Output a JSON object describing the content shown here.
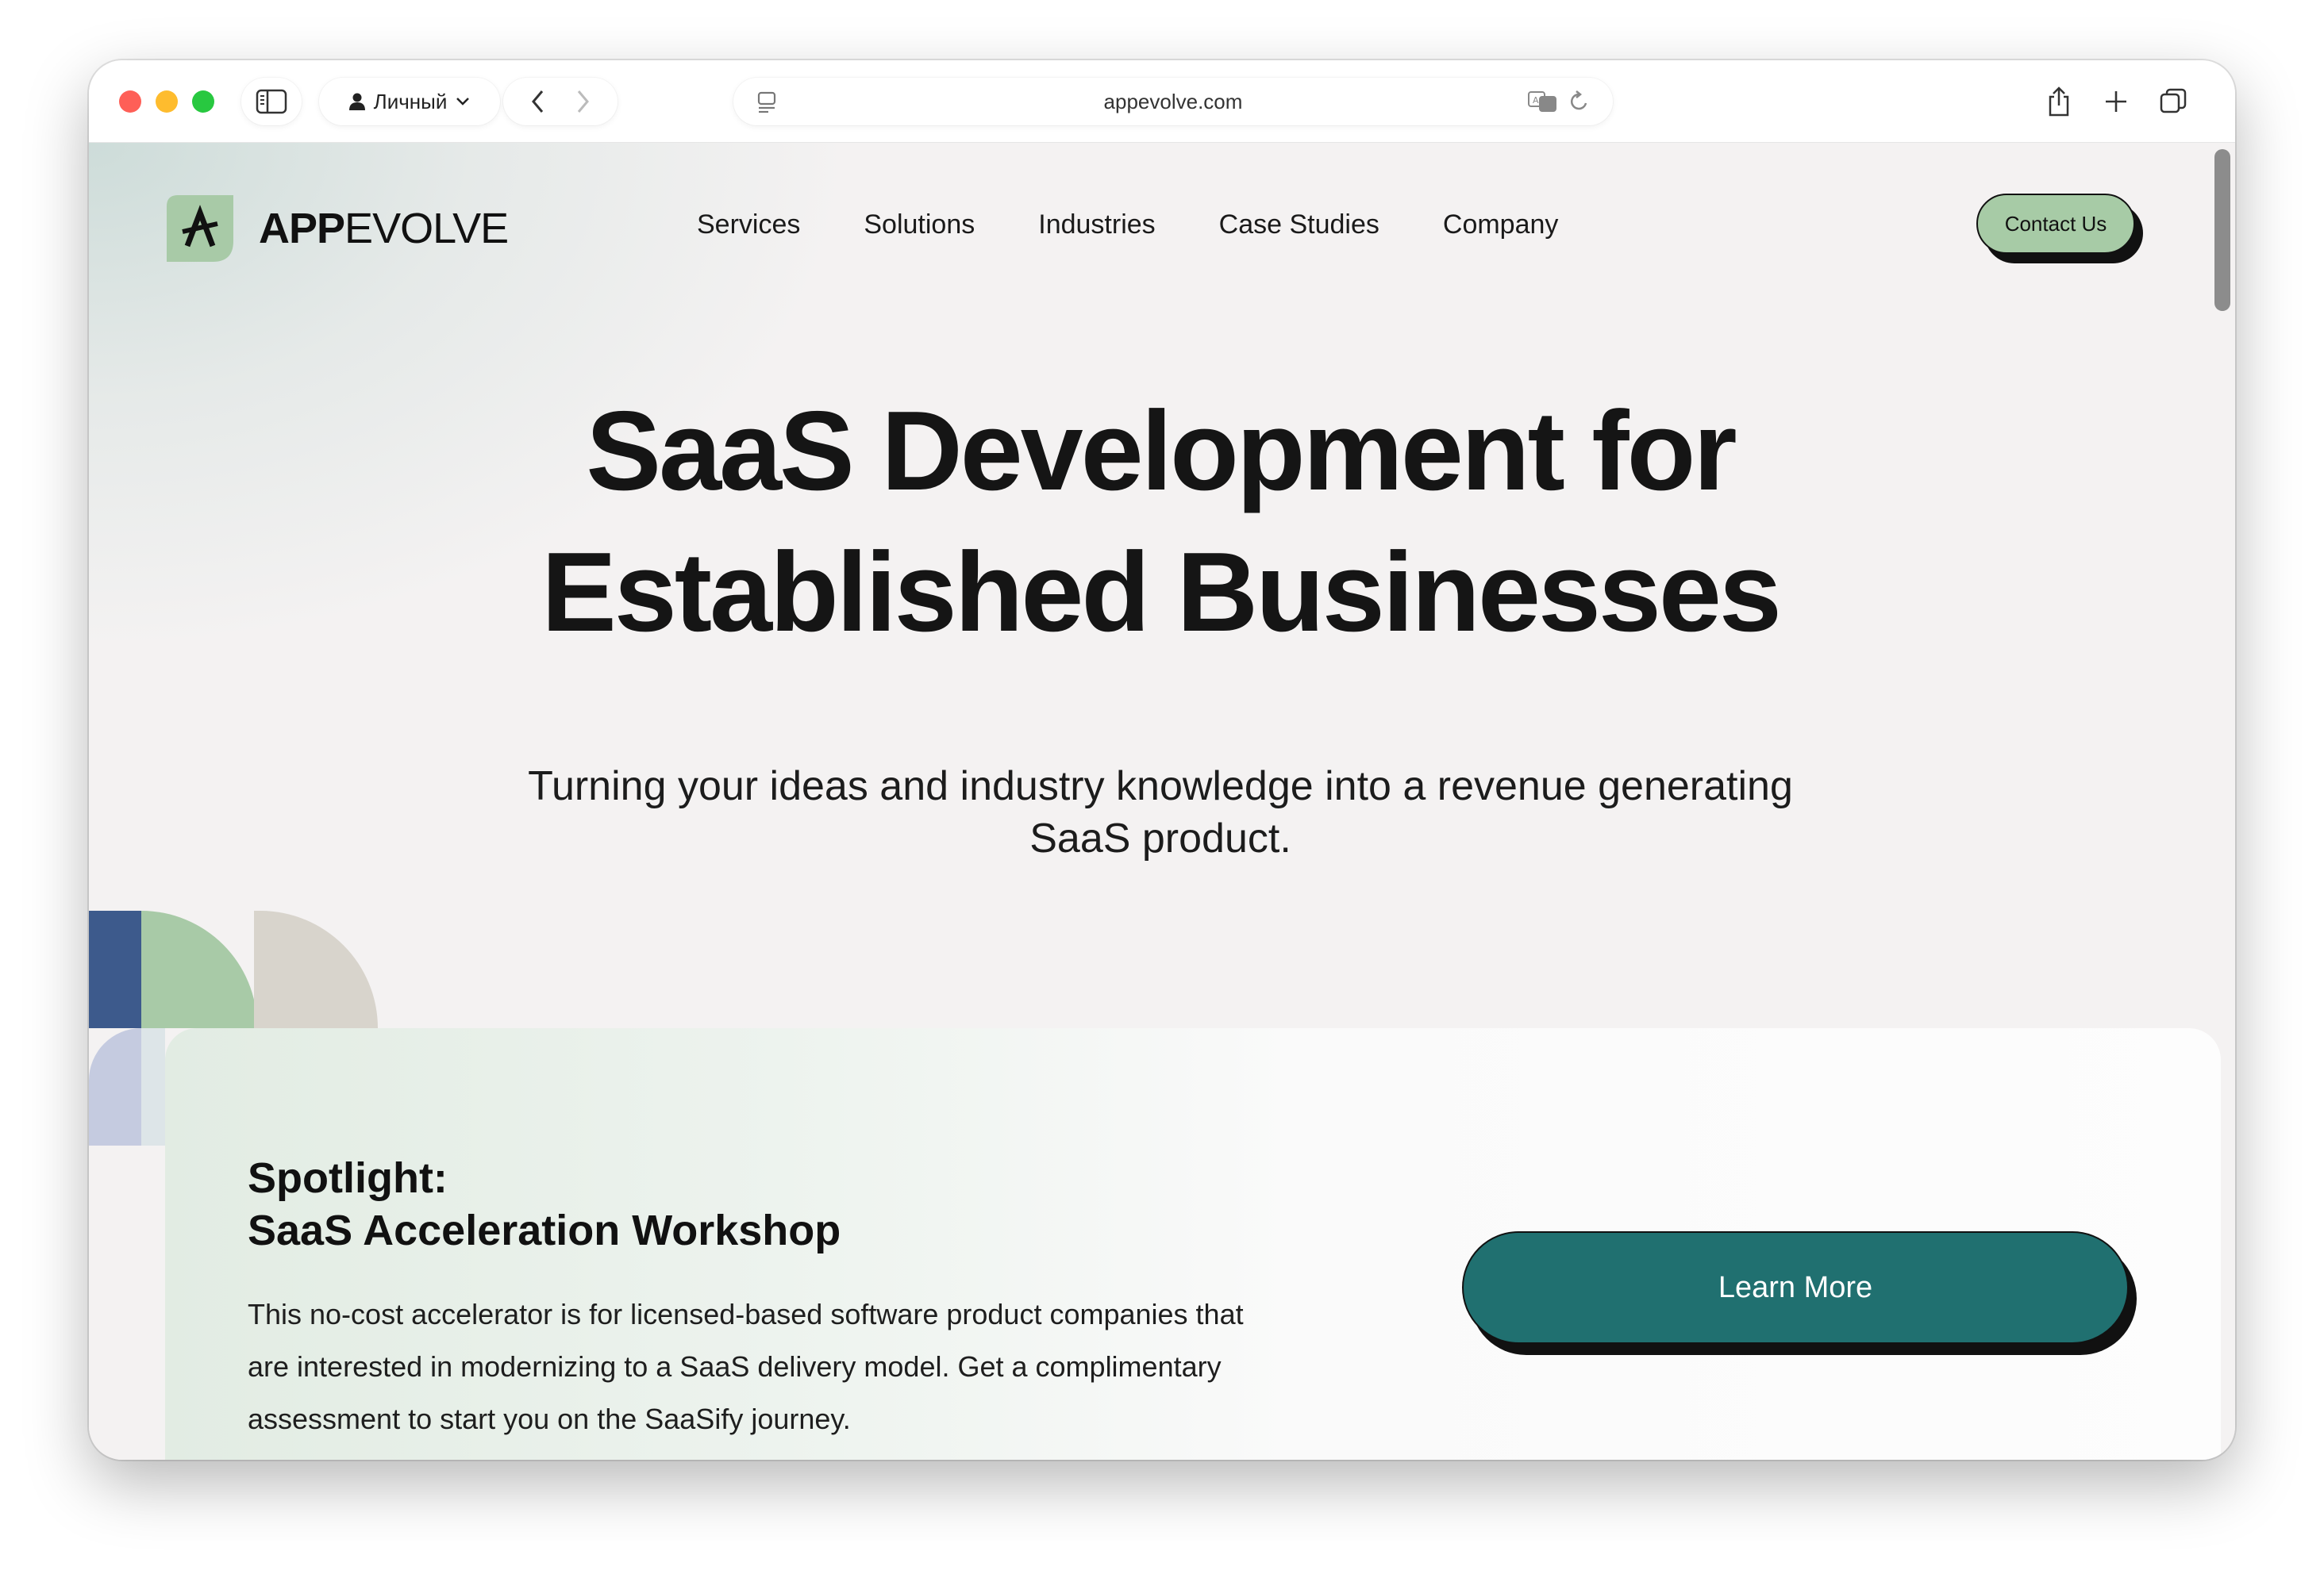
{
  "browser": {
    "profile_label": "Личный",
    "address": "appevolve.com"
  },
  "site": {
    "logo_bold": "APP",
    "logo_light": "EVOLVE",
    "nav": [
      "Services",
      "Solutions",
      "Industries",
      "Case Studies",
      "Company"
    ],
    "contact_label": "Contact Us"
  },
  "hero": {
    "title_line1": "SaaS Development for",
    "title_line2": "Established Businesses",
    "subtitle_line1": "Turning your ideas and industry knowledge into a revenue generating",
    "subtitle_line2": "SaaS product."
  },
  "spotlight": {
    "title_line1": "Spotlight:",
    "title_line2": "SaaS Acceleration Workshop",
    "description_line1": "This no-cost accelerator is for licensed-based software product companies that",
    "description_line2": "are interested in modernizing to a SaaS delivery model. Get a complimentary",
    "description_line3": "assessment to start you on the SaaSify journey.",
    "button_label": "Learn More"
  },
  "colors": {
    "brand_green": "#a8caa7",
    "brand_teal": "#207070",
    "brand_blue": "#3d5a8c",
    "lavender": "#c5cbe0",
    "beige": "#d8d4cc"
  },
  "icons": {
    "sidebar": "sidebar-icon",
    "profile": "person-icon",
    "back": "chevron-left-icon",
    "forward": "chevron-right-icon",
    "page": "page-menu-icon",
    "translate": "translate-icon",
    "reload": "reload-icon",
    "share": "share-icon",
    "new_tab": "plus-icon",
    "tabs": "tab-overview-icon"
  }
}
